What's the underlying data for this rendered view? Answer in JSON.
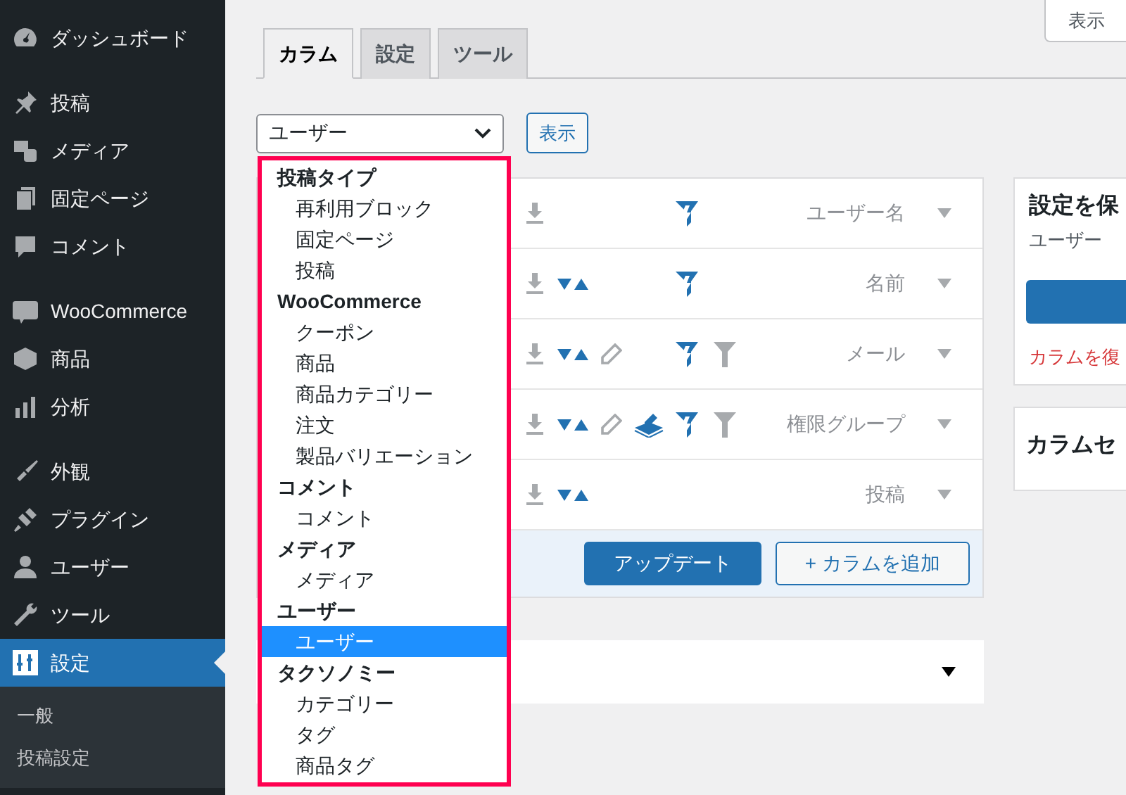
{
  "sidebar": {
    "groups": [
      [
        {
          "label": "ダッシュボード",
          "kind": "dashboard",
          "selected": false
        }
      ],
      [
        {
          "label": "投稿",
          "kind": "pin",
          "selected": false
        },
        {
          "label": "メディア",
          "kind": "media",
          "selected": false
        },
        {
          "label": "固定ページ",
          "kind": "pages",
          "selected": false
        },
        {
          "label": "コメント",
          "kind": "comment",
          "selected": false
        }
      ],
      [
        {
          "label": "WooCommerce",
          "kind": "woo",
          "selected": false
        },
        {
          "label": "商品",
          "kind": "box",
          "selected": false
        },
        {
          "label": "分析",
          "kind": "chart",
          "selected": false
        }
      ],
      [
        {
          "label": "外観",
          "kind": "brush",
          "selected": false
        },
        {
          "label": "プラグイン",
          "kind": "plug",
          "selected": false
        },
        {
          "label": "ユーザー",
          "kind": "user",
          "selected": false
        },
        {
          "label": "ツール",
          "kind": "wrench",
          "selected": false
        },
        {
          "label": "設定",
          "kind": "settings",
          "selected": true
        }
      ]
    ],
    "submenu": [
      "一般",
      "投稿設定"
    ]
  },
  "screen_options": "表示",
  "tabs": [
    {
      "label": "カラム",
      "selected": true
    },
    {
      "label": "設定",
      "selected": false
    },
    {
      "label": "ツール",
      "selected": false
    }
  ],
  "list_screen": {
    "value": "ユーザー",
    "button": "表示"
  },
  "dropdown": [
    {
      "group": "投稿タイプ",
      "options": [
        {
          "label": "再利用ブロック",
          "selected": false
        },
        {
          "label": "固定ページ",
          "selected": false
        },
        {
          "label": "投稿",
          "selected": false
        }
      ]
    },
    {
      "group": "WooCommerce",
      "options": [
        {
          "label": "クーポン",
          "selected": false
        },
        {
          "label": "商品",
          "selected": false
        },
        {
          "label": "商品カテゴリー",
          "selected": false
        },
        {
          "label": "注文",
          "selected": false
        },
        {
          "label": "製品バリエーション",
          "selected": false
        }
      ]
    },
    {
      "group": "コメント",
      "options": [
        {
          "label": "コメント",
          "selected": false
        }
      ]
    },
    {
      "group": "メディア",
      "options": [
        {
          "label": "メディア",
          "selected": false
        }
      ]
    },
    {
      "group": "ユーザー",
      "options": [
        {
          "label": "ユーザー",
          "selected": true
        }
      ]
    },
    {
      "group": "タクソノミー",
      "options": [
        {
          "label": "カテゴリー",
          "selected": false
        },
        {
          "label": "タグ",
          "selected": false
        },
        {
          "label": "商品タグ",
          "selected": false
        }
      ]
    }
  ],
  "columns": [
    {
      "label": "ユーザー名",
      "sortable": false,
      "editable": false,
      "bulk_editable": false,
      "smart_filter": true,
      "filterable": false
    },
    {
      "label": "名前",
      "sortable": true,
      "editable": false,
      "bulk_editable": false,
      "smart_filter": true,
      "filterable": false
    },
    {
      "label": "メール",
      "sortable": true,
      "editable": true,
      "bulk_editable": false,
      "smart_filter": true,
      "filterable": true
    },
    {
      "label": "権限グループ",
      "sortable": true,
      "editable": true,
      "bulk_editable": true,
      "smart_filter": true,
      "filterable": true
    },
    {
      "label": "投稿",
      "sortable": true,
      "editable": false,
      "bulk_editable": false,
      "smart_filter": false,
      "filterable": false
    }
  ],
  "footer_buttons": {
    "update": "アップデート",
    "add": "+ カラムを追加"
  },
  "save_box": {
    "title": "設定を保",
    "subtitle": "ユーザー",
    "restore": "カラムを復"
  },
  "sets_box": {
    "title": "カラムセ"
  }
}
